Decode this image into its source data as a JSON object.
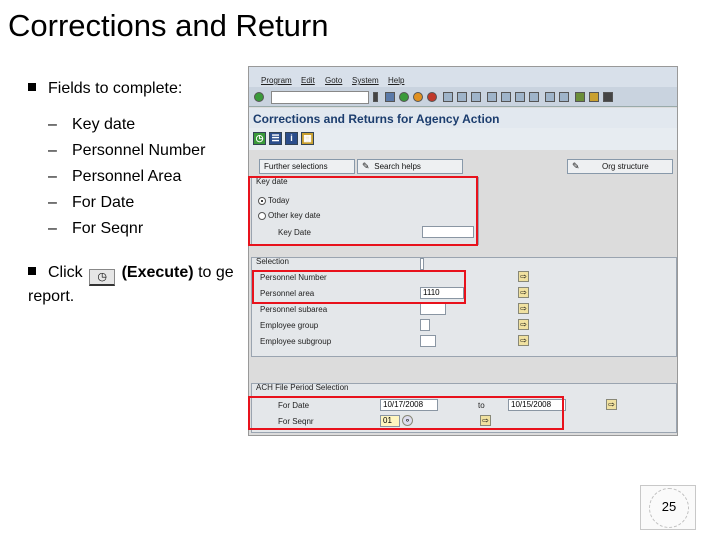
{
  "slide": {
    "title": "Corrections and Return",
    "bullet1": "Fields to complete:",
    "fields": [
      "Key date",
      "Personnel Number",
      "Personnel Area",
      "For Date",
      "For Seqnr"
    ],
    "bullet2_prefix": "Click",
    "bullet2_bold": "(Execute)",
    "bullet2_suffix": "to ge",
    "bullet2_line2": "report.",
    "dash": "–",
    "page_number": "25"
  },
  "sap": {
    "menu": [
      "Program",
      "Edit",
      "Goto",
      "System",
      "Help"
    ],
    "transaction_title": "Corrections and Returns for Agency Action",
    "app_toolbar": {
      "further_selections": "Further selections",
      "search_helps": "Search helps",
      "org_structure": "Org structure"
    },
    "key_date_group": {
      "title": "Key date",
      "option1": "Today",
      "option2": "Other key date",
      "key_date_label": "Key Date",
      "key_date_value": ""
    },
    "selection_group": {
      "title": "Selection",
      "rows": [
        {
          "label": "Personnel Number",
          "value": ""
        },
        {
          "label": "Personnel area",
          "value": "1110"
        },
        {
          "label": "Personnel subarea",
          "value": ""
        },
        {
          "label": "Employee group",
          "value": ""
        },
        {
          "label": "Employee subgroup",
          "value": ""
        }
      ]
    },
    "ach_group": {
      "title": "ACH File Period Selection",
      "for_date_label": "For Date",
      "for_date_from": "10/17/2008",
      "to_label": "to",
      "for_date_to": "10/15/2008",
      "for_seqnr_label": "For Seqnr",
      "for_seqnr_value": "01"
    }
  },
  "colors": {
    "highlight": "#e8121c",
    "sap_title": "#1c3d6e"
  },
  "icons": {
    "execute": "execute-icon",
    "multiple_selection": "multiple-selection-icon"
  }
}
